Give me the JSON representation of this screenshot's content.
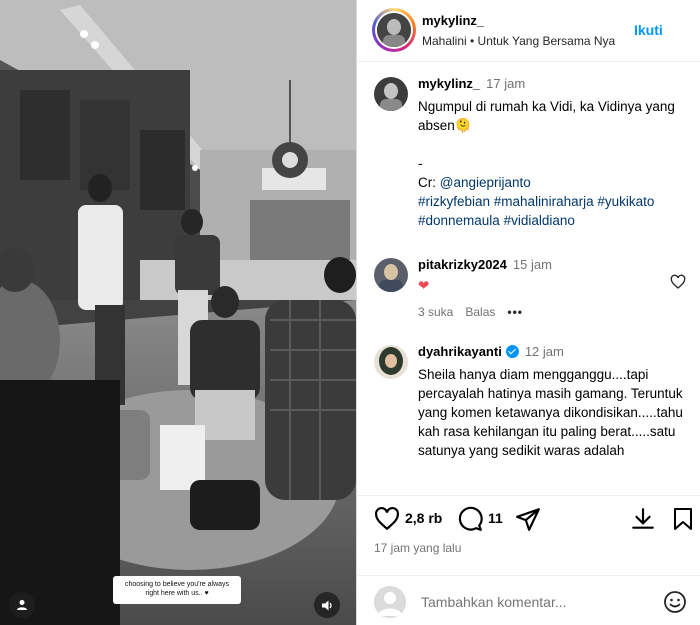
{
  "media": {
    "sticker_text": "choosing to believe you're always right here with us.. ♥"
  },
  "header": {
    "username": "mykylinz_",
    "music": "Mahalini • Untuk Yang Bersama Nya",
    "follow_label": "Ikuti"
  },
  "caption": {
    "username": "mykylinz_",
    "time": "17 jam",
    "line1": "Ngumpul di rumah ka Vidi, ka Vidinya yang absen🫠",
    "dash": "-",
    "credit_prefix": "Cr: ",
    "credit_handle": "@angieprijanto",
    "hashtags": "#rizkyfebian #mahaliniraharja #yukikato #donnemaula #vidialdiano"
  },
  "comments": [
    {
      "username": "pitakrizky2024",
      "time": "15 jam",
      "text": "❤",
      "likes": "3 suka",
      "reply": "Balas",
      "more": "•••"
    },
    {
      "username": "dyahrikayanti",
      "time": "12 jam",
      "text": "Sheila hanya diam mengganggu....tapi percayalah hatinya masih gamang. Teruntuk yang komen ketawanya dikondisikan.....tahu kah rasa kehilangan itu paling berat.....satu satunya yang sedikit waras adalah"
    }
  ],
  "actions": {
    "like_count": "2,8 rb",
    "comment_count": "11",
    "posted": "17 jam yang lalu"
  },
  "add_comment": {
    "placeholder": "Tambahkan komentar..."
  },
  "colors": {
    "accent": "#0095f6",
    "link": "#00376b",
    "like_red": "#ed4956",
    "muted": "#737373"
  }
}
